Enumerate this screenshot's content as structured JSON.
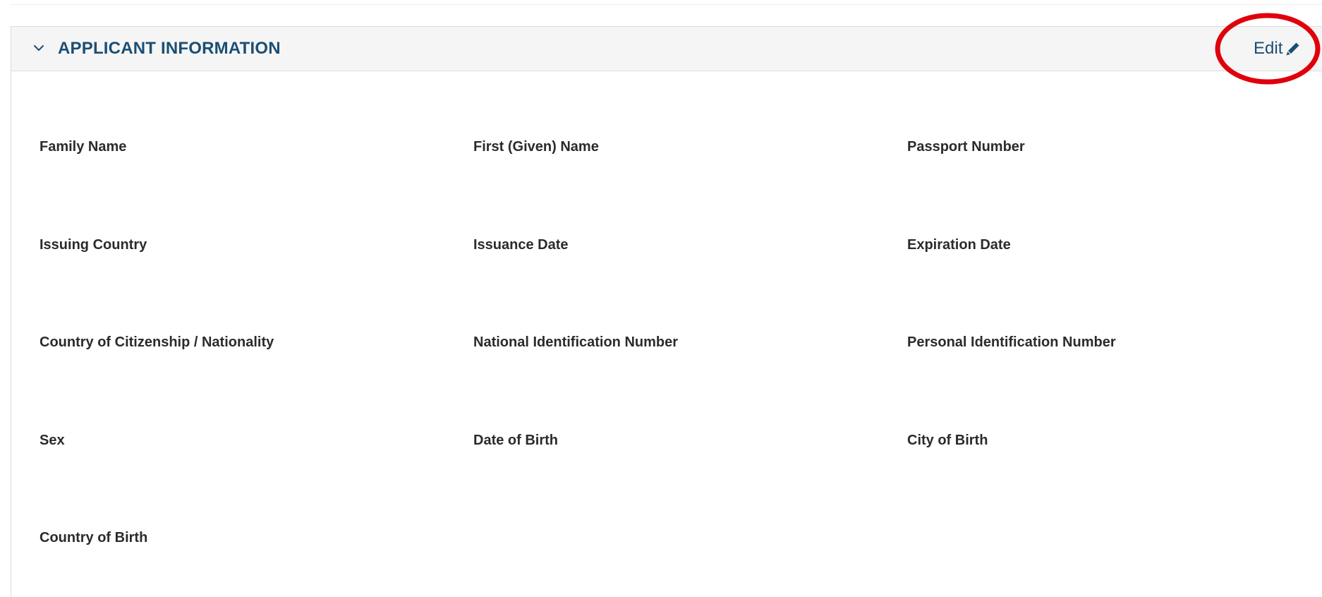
{
  "section": {
    "title": "APPLICANT INFORMATION",
    "edit_label": "Edit",
    "collapse_icon": "chevron-down-icon",
    "edit_icon": "pencil-icon",
    "highlight_color": "#e0000b",
    "title_color": "#1c4e73"
  },
  "fields": {
    "family_name": "Family Name",
    "first_given_name": "First (Given) Name",
    "passport_number": "Passport Number",
    "issuing_country": "Issuing Country",
    "issuance_date": "Issuance Date",
    "expiration_date": "Expiration Date",
    "country_of_citizenship": "Country of Citizenship / Nationality",
    "national_identification_number": "National Identification Number",
    "personal_identification_number": "Personal Identification Number",
    "sex": "Sex",
    "date_of_birth": "Date of Birth",
    "city_of_birth": "City of Birth",
    "country_of_birth": "Country of Birth"
  }
}
